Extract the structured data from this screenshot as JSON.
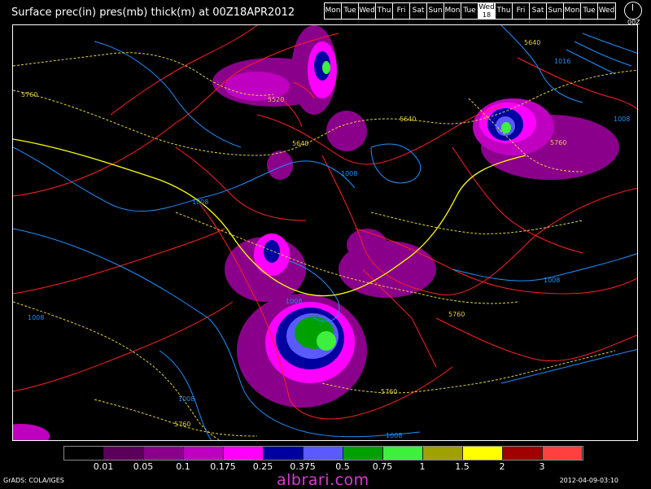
{
  "title": "Surface prec(in) pres(mb) thick(m) at 00Z18APR2012",
  "days": [
    {
      "label": "Mon"
    },
    {
      "label": "Tue"
    },
    {
      "label": "Wed"
    },
    {
      "label": "Thu"
    },
    {
      "label": "Fri"
    },
    {
      "label": "Sat"
    },
    {
      "label": "Sun"
    },
    {
      "label": "Mon"
    },
    {
      "label": "Tue"
    },
    {
      "label": "Wed",
      "sub": "18",
      "selected": true
    },
    {
      "label": "Thu"
    },
    {
      "label": "Fri"
    },
    {
      "label": "Sat"
    },
    {
      "label": "Sun"
    },
    {
      "label": "Mon"
    },
    {
      "label": "Tue"
    },
    {
      "label": "Wed"
    }
  ],
  "clock_label": "00Z",
  "contour_labels": {
    "pressure": [
      "1008",
      "1008",
      "1008",
      "1008",
      "1008",
      "1008",
      "1008",
      "1016",
      "1008"
    ],
    "thickness": [
      "5760",
      "5520",
      "5640",
      "5640",
      "5640",
      "5760",
      "5760",
      "5760",
      "5760"
    ]
  },
  "legend": {
    "colors": [
      "#000000",
      "#5a005a",
      "#8b008b",
      "#c000c0",
      "#ff00ff",
      "#0000a0",
      "#5a5aff",
      "#00a000",
      "#3cf03c",
      "#a0a000",
      "#ffff00",
      "#a00000",
      "#ff4040"
    ],
    "labels": [
      "0.01",
      "0.05",
      "0.1",
      "0.175",
      "0.25",
      "0.375",
      "0.5",
      "0.75",
      "1",
      "1.5",
      "2",
      "3"
    ]
  },
  "footer_left": "GrADS: COLA/IGES",
  "footer_right": "2012-04-09-03:10",
  "watermark": "albrari.com"
}
